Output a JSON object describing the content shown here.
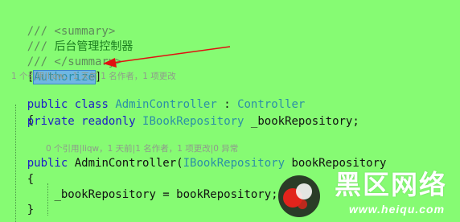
{
  "code": {
    "summary_open": "/// <summary>",
    "summary_prefix": "/// ",
    "summary_text": "后台管理控制器",
    "summary_close": "/// </summary>",
    "attr_open": "[",
    "attr_name": "Authorize",
    "attr_close": "]",
    "codelens_class": "1 个引用|liqw，1 天前|1 名作者，1 项更改",
    "class_kw1": "public",
    "class_kw2": "class",
    "class_name": "AdminController",
    "class_colon": ":",
    "base_class": "Controller",
    "brace_open": "{",
    "field_kw1": "private",
    "field_kw2": "readonly",
    "field_type": "IBookRepository",
    "field_name": "_bookRepository;",
    "codelens_ctor": "0 个引用|liqw，1 天前|1 名作者，1 项更改|0 异常",
    "ctor_kw": "public",
    "ctor_name": "AdminController(",
    "ctor_param_type": "IBookRepository",
    "ctor_param_name": "bookRepository",
    "ctor_brace_open": "{",
    "assign_stmt": "_bookRepository = bookRepository;",
    "ctor_brace_close": "}"
  },
  "watermark": {
    "title": "黑区网络",
    "url": "www.heiqu.com"
  },
  "colors": {
    "background": "#86fb73",
    "keyword": "#1c1cc8",
    "type": "#2c8fa6",
    "comment": "#5f8a5b",
    "codelens": "#8f9a8c",
    "selection": "#6fb7e3",
    "arrow": "#e01010"
  }
}
